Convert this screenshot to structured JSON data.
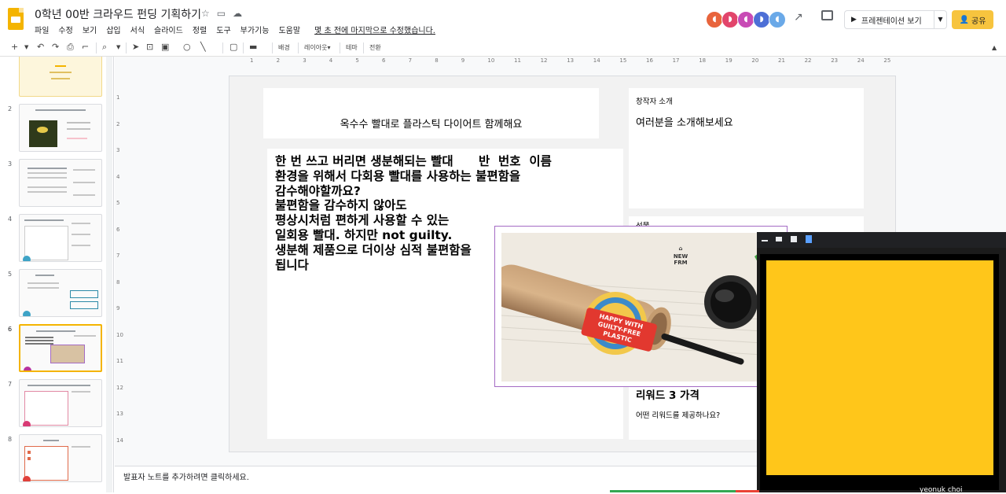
{
  "app": {
    "doc_title": "0학년 00반 크라우드 펀딩 기획하기",
    "menu": [
      "파일",
      "수정",
      "보기",
      "삽입",
      "서식",
      "슬라이드",
      "정렬",
      "도구",
      "부가기능",
      "도움말"
    ],
    "last_edit": "몇 초 전에 마지막으로 수정했습니다.",
    "present_label": "프레젠테이션 보기",
    "share_label": "공유"
  },
  "toolbar": {
    "background_label": "배경",
    "layout_label": "레이아웃▾",
    "theme_label": "테마",
    "transition_label": "전환"
  },
  "filmstrip": {
    "slides": [
      {
        "number": ""
      },
      {
        "number": "2"
      },
      {
        "number": "3"
      },
      {
        "number": "4"
      },
      {
        "number": "5"
      },
      {
        "number": "6",
        "selected": true
      },
      {
        "number": "7"
      },
      {
        "number": "8"
      }
    ]
  },
  "ruler": {
    "h_ticks": [
      "1",
      "2",
      "3",
      "4",
      "5",
      "6",
      "7",
      "8",
      "9",
      "10",
      "11",
      "12",
      "13",
      "14",
      "15",
      "16",
      "17",
      "18",
      "19",
      "20",
      "21",
      "22",
      "23",
      "24",
      "25"
    ],
    "v_ticks": [
      "1",
      "2",
      "3",
      "4",
      "5",
      "6",
      "7",
      "8",
      "9",
      "10",
      "11",
      "12",
      "13",
      "14"
    ]
  },
  "slide": {
    "title": "옥수수 빨대로 플라스틱 다이어트 함께해요",
    "body": "한 번 쓰고 버리면 생분해되는 빨대      반  번호  이름\n환경을 위해서 다회용 빨대를 사용하는 불편함을\n감수해야할까요?\n불편함을 감수하지 않아도\n평상시처럼 편하게 사용할 수 있는\n일회용 빨대. 하지만 not guilty.\n생분해 제품으로 더이상 심적 불편함을\n됩니다",
    "creator_label": "창작자 소개",
    "creator_heading": "여러분을 소개해보세요",
    "price_label": "선물",
    "reward_heading": "리워드 3 가격",
    "reward_question": "어떤 리워드를 제공하나요?"
  },
  "photo": {
    "brand_top": "NEW",
    "brand_bottom": "FRM",
    "sticker_lines": [
      "HAPPY WITH",
      "GUILTY-FREE",
      "PLASTIC"
    ]
  },
  "notes": {
    "placeholder": "발표자 노트를 추가하려면 클릭하세요."
  },
  "video": {
    "participant_name": "yeonuk choi"
  },
  "colors": {
    "accent": "#f4b400",
    "share": "#f7c43e",
    "video_bg": "#ffc61a",
    "image_border": "#a46bc4"
  }
}
